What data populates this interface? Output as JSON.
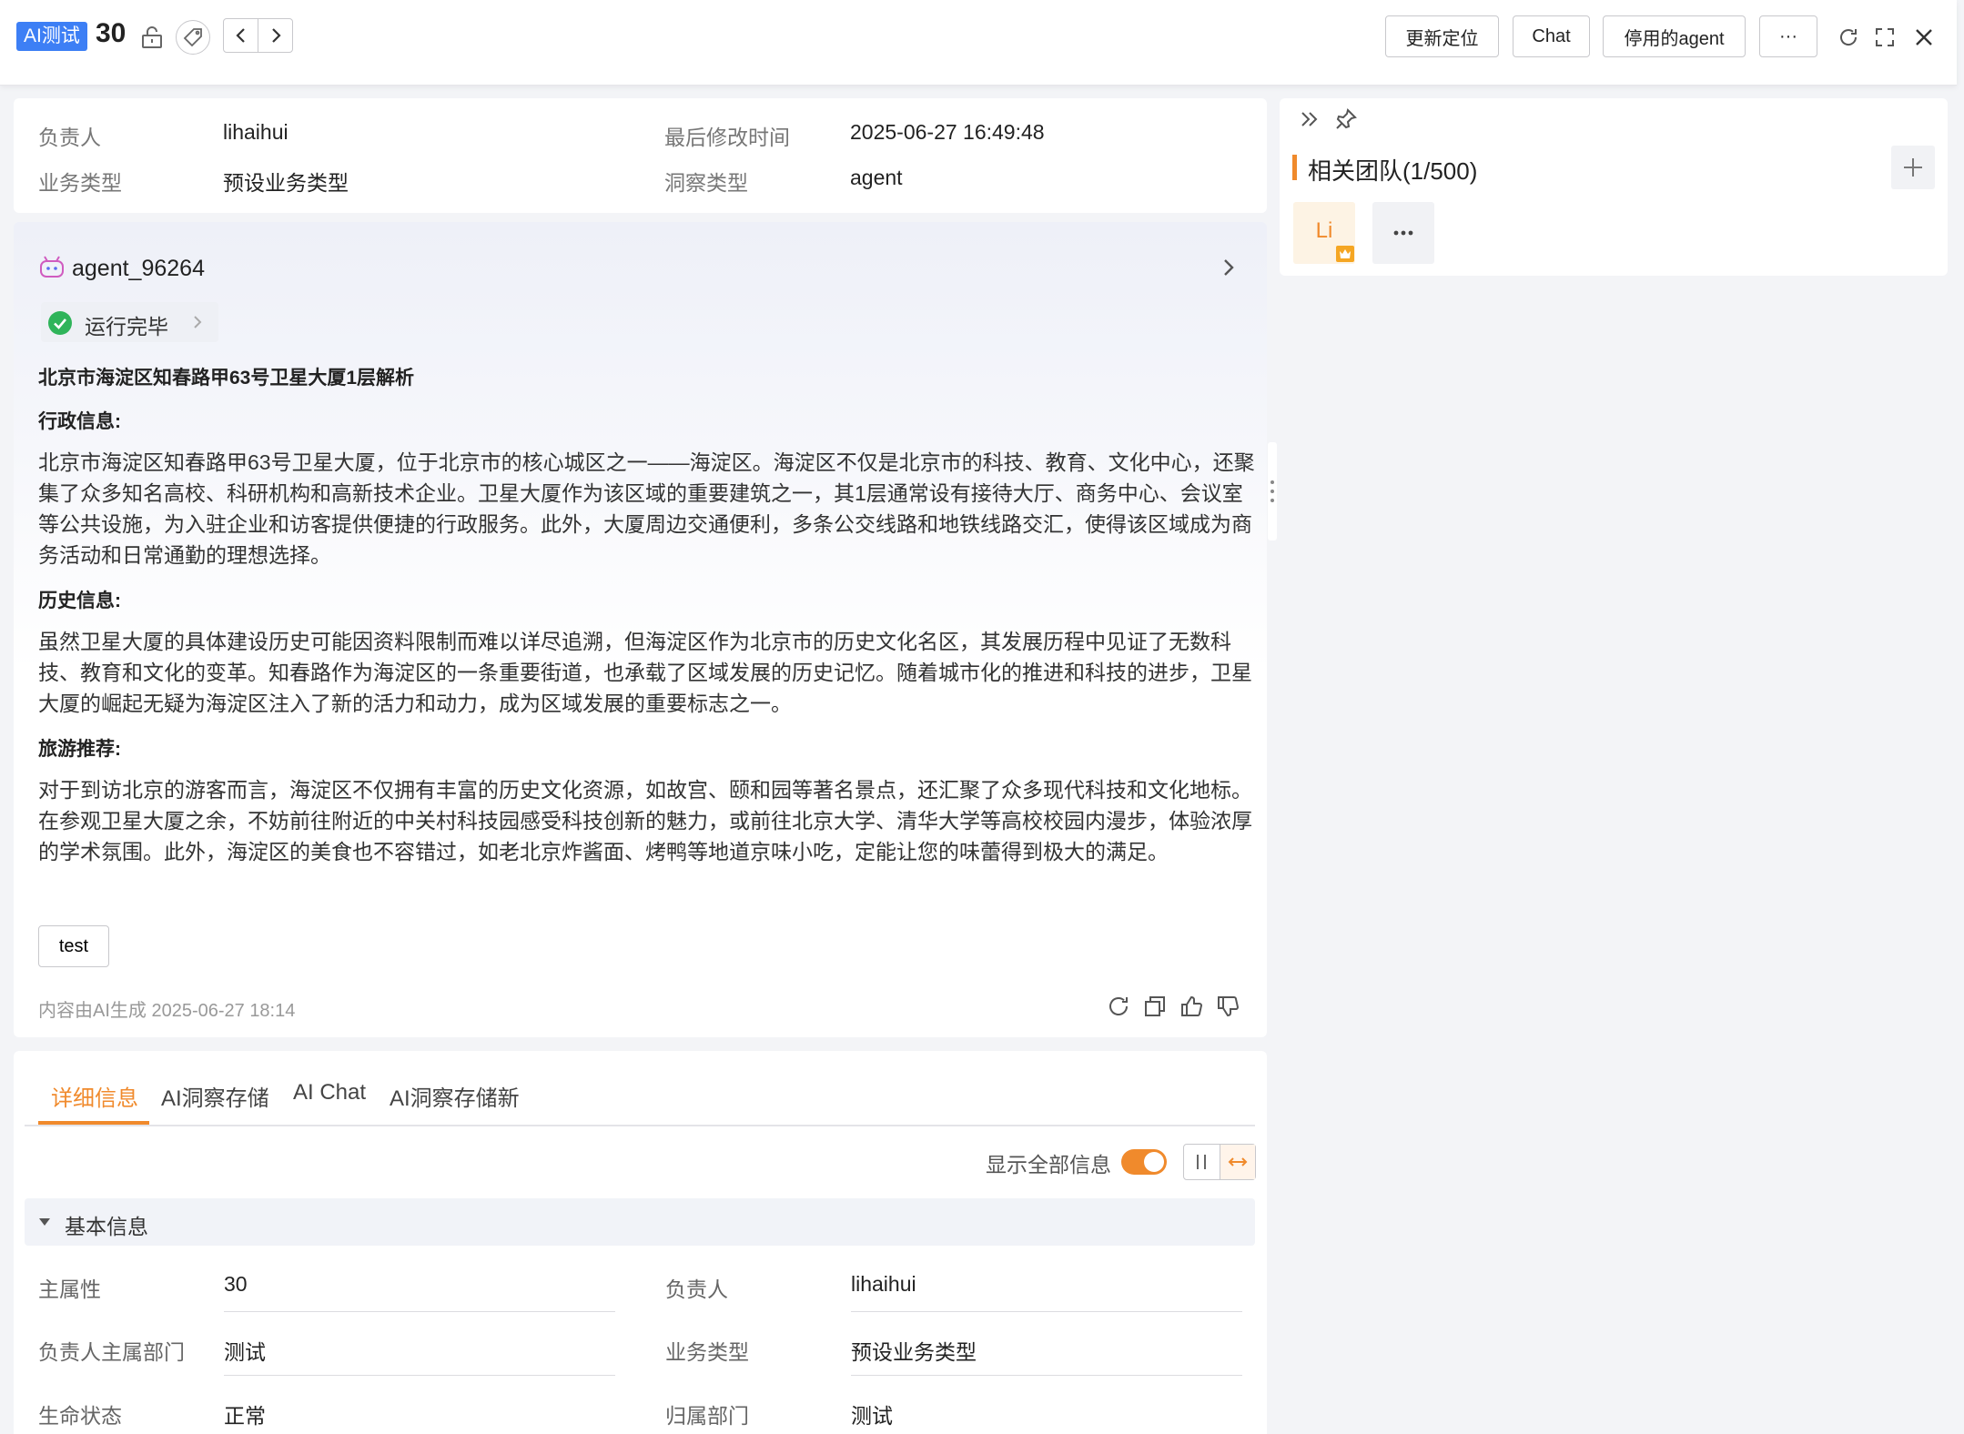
{
  "header": {
    "badge": "AI测试",
    "record_id": "30",
    "buttons": {
      "update_location": "更新定位",
      "chat": "Chat",
      "disabled_agent": "停用的agent",
      "more": "···"
    }
  },
  "summary": {
    "owner_label": "负责人",
    "owner_value": "lihaihui",
    "modified_label": "最后修改时间",
    "modified_value": "2025-06-27 16:49:48",
    "biz_type_label": "业务类型",
    "biz_type_value": "预设业务类型",
    "insight_type_label": "洞察类型",
    "insight_type_value": "agent"
  },
  "ai_card": {
    "agent_name": "agent_96264",
    "status": "运行完毕",
    "title": "北京市海淀区知春路甲63号卫星大厦1层解析",
    "sections": [
      {
        "heading": "行政信息:",
        "body": "北京市海淀区知春路甲63号卫星大厦，位于北京市的核心城区之一——海淀区。海淀区不仅是北京市的科技、教育、文化中心，还聚集了众多知名高校、科研机构和高新技术企业。卫星大厦作为该区域的重要建筑之一，其1层通常设有接待大厅、商务中心、会议室等公共设施，为入驻企业和访客提供便捷的行政服务。此外，大厦周边交通便利，多条公交线路和地铁线路交汇，使得该区域成为商务活动和日常通勤的理想选择。"
      },
      {
        "heading": "历史信息:",
        "body": "虽然卫星大厦的具体建设历史可能因资料限制而难以详尽追溯，但海淀区作为北京市的历史文化名区，其发展历程中见证了无数科技、教育和文化的变革。知春路作为海淀区的一条重要街道，也承载了区域发展的历史记忆。随着城市化的推进和科技的进步，卫星大厦的崛起无疑为海淀区注入了新的活力和动力，成为区域发展的重要标志之一。"
      },
      {
        "heading": "旅游推荐:",
        "body": "对于到访北京的游客而言，海淀区不仅拥有丰富的历史文化资源，如故宫、颐和园等著名景点，还汇聚了众多现代科技和文化地标。在参观卫星大厦之余，不妨前往附近的中关村科技园感受科技创新的魅力，或前往北京大学、清华大学等高校校园内漫步，体验浓厚的学术氛围。此外，海淀区的美食也不容错过，如老北京炸酱面、烤鸭等地道京味小吃，定能让您的味蕾得到极大的满足。"
      }
    ],
    "tag_button": "test",
    "footer_note": "内容由AI生成 2025-06-27 18:14"
  },
  "tabs": [
    "详细信息",
    "AI洞察存储",
    "AI Chat",
    "AI洞察存储新"
  ],
  "detail": {
    "show_all_label": "显示全部信息",
    "show_all_on": true,
    "section_title": "基本信息",
    "fields": [
      {
        "label": "主属性",
        "value": "30"
      },
      {
        "label": "负责人",
        "value": "lihaihui"
      },
      {
        "label": "负责人主属部门",
        "value": "测试"
      },
      {
        "label": "业务类型",
        "value": "预设业务类型"
      },
      {
        "label": "生命状态",
        "value": "正常"
      },
      {
        "label": "归属部门",
        "value": "测试"
      }
    ]
  },
  "side": {
    "team_title": "相关团队(1/500)",
    "member_avatar": "Li"
  },
  "colors": {
    "accent": "#f08a2c",
    "badge_blue": "#3d7ff5",
    "status_green": "#2fb45a"
  }
}
